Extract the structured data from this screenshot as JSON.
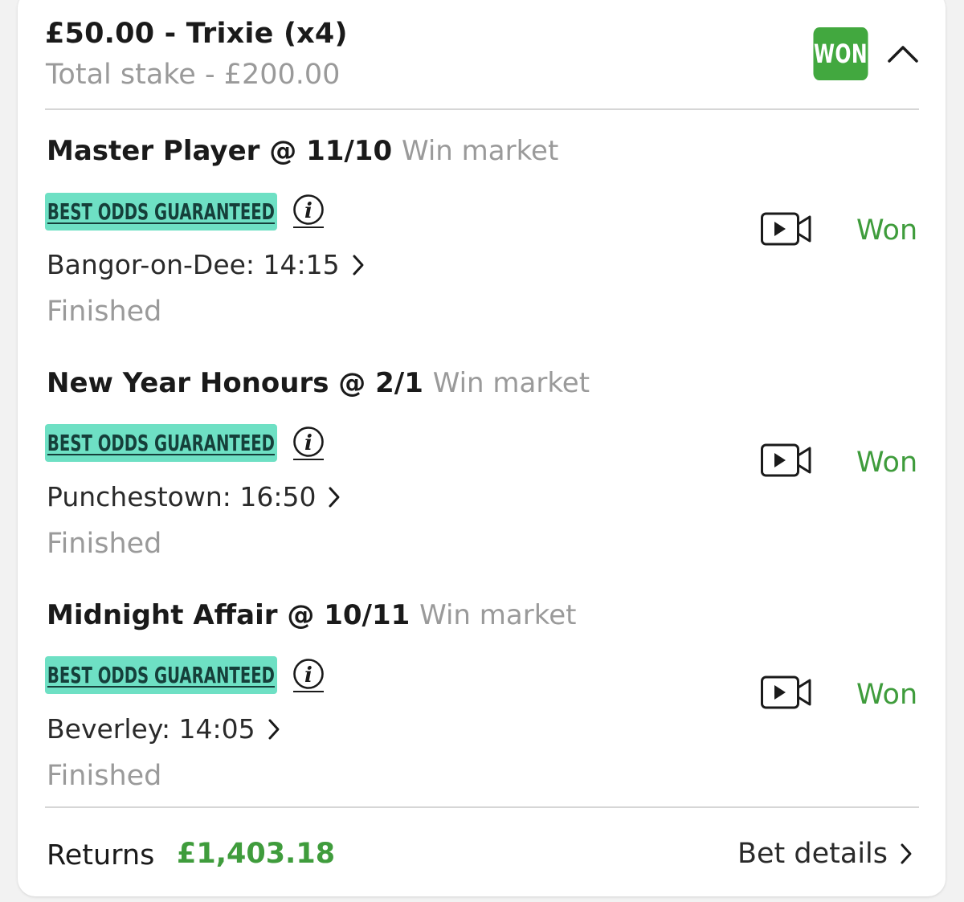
{
  "header": {
    "title": "£50.00 - Trixie (x4)",
    "total_stake": "Total stake - £200.00",
    "status_badge": "WON",
    "collapse_icon": "chevron-up-icon"
  },
  "selections": [
    {
      "runner": "Master Player @ 11/10",
      "market": "Win market",
      "badge": "BEST ODDS GUARANTEED",
      "event": "Bangor-on-Dee: 14:15",
      "status": "Finished",
      "result": "Won"
    },
    {
      "runner": "New Year Honours @ 2/1",
      "market": "Win market",
      "badge": "BEST ODDS GUARANTEED",
      "event": "Punchestown: 16:50",
      "status": "Finished",
      "result": "Won"
    },
    {
      "runner": "Midnight Affair @ 10/11",
      "market": "Win market",
      "badge": "BEST ODDS GUARANTEED",
      "event": "Beverley: 14:05",
      "status": "Finished",
      "result": "Won"
    }
  ],
  "footer": {
    "returns_label": "Returns",
    "returns_value": "£1,403.18",
    "bet_details": "Bet details"
  },
  "colors": {
    "won_green": "#42a83f",
    "bog_teal": "#6ee0c4",
    "muted_grey": "#9a9a9a"
  }
}
